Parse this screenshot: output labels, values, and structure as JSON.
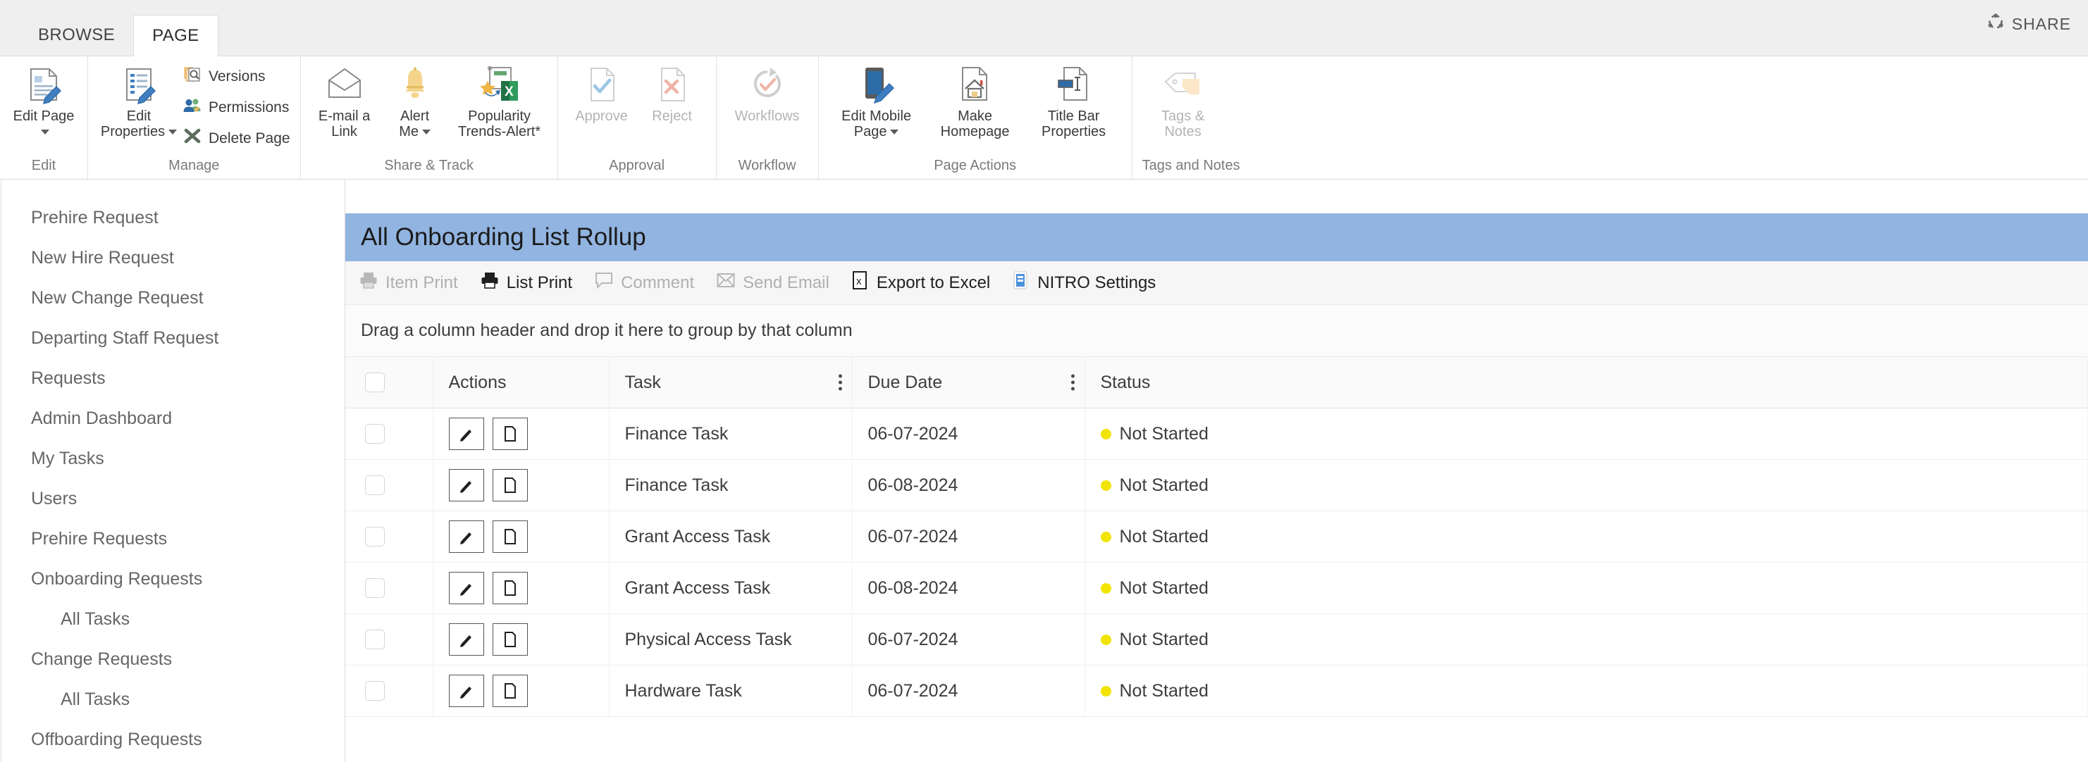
{
  "ribbon": {
    "tabs": [
      {
        "label": "BROWSE",
        "active": false
      },
      {
        "label": "PAGE",
        "active": true
      }
    ],
    "share_label": "SHARE",
    "groups": [
      {
        "label": "Edit",
        "buttons": [
          {
            "label": "Edit Page",
            "icon": "edit-page-icon",
            "dropdown": true,
            "disabled": false
          }
        ]
      },
      {
        "label": "Manage",
        "buttons": [
          {
            "label": "Edit\nProperties",
            "icon": "edit-properties-icon",
            "dropdown": true,
            "disabled": false
          }
        ],
        "small_items": [
          {
            "label": "Versions",
            "icon": "versions-icon"
          },
          {
            "label": "Permissions",
            "icon": "permissions-icon"
          },
          {
            "label": "Delete Page",
            "icon": "delete-page-icon"
          }
        ]
      },
      {
        "label": "Share & Track",
        "buttons": [
          {
            "label": "E-mail a\nLink",
            "icon": "email-link-icon",
            "dropdown": false,
            "disabled": false
          },
          {
            "label": "Alert\nMe",
            "icon": "alert-bell-icon",
            "dropdown": true,
            "disabled": false
          },
          {
            "label": "Popularity\nTrends-Alert*",
            "icon": "popularity-trends-icon",
            "dropdown": false,
            "disabled": false
          }
        ]
      },
      {
        "label": "Approval",
        "buttons": [
          {
            "label": "Approve",
            "icon": "approve-icon",
            "dropdown": false,
            "disabled": true
          },
          {
            "label": "Reject",
            "icon": "reject-icon",
            "dropdown": false,
            "disabled": true
          }
        ]
      },
      {
        "label": "Workflow",
        "buttons": [
          {
            "label": "Workflows",
            "icon": "workflows-icon",
            "dropdown": false,
            "disabled": true
          }
        ]
      },
      {
        "label": "Page Actions",
        "buttons": [
          {
            "label": "Edit Mobile\nPage",
            "icon": "edit-mobile-page-icon",
            "dropdown": true,
            "disabled": false
          },
          {
            "label": "Make\nHomepage",
            "icon": "make-homepage-icon",
            "dropdown": false,
            "disabled": false
          },
          {
            "label": "Title Bar\nProperties",
            "icon": "title-bar-properties-icon",
            "dropdown": false,
            "disabled": false
          }
        ]
      },
      {
        "label": "Tags and Notes",
        "buttons": [
          {
            "label": "Tags &\nNotes",
            "icon": "tags-notes-icon",
            "dropdown": false,
            "disabled": true
          }
        ]
      }
    ]
  },
  "sidebar": {
    "items": [
      {
        "label": "Prehire Request",
        "sub": false
      },
      {
        "label": "New Hire Request",
        "sub": false
      },
      {
        "label": "New Change Request",
        "sub": false
      },
      {
        "label": "Departing Staff Request",
        "sub": false
      },
      {
        "label": "Requests",
        "sub": false
      },
      {
        "label": "Admin Dashboard",
        "sub": false
      },
      {
        "label": "My Tasks",
        "sub": false
      },
      {
        "label": "Users",
        "sub": false
      },
      {
        "label": "Prehire Requests",
        "sub": false
      },
      {
        "label": "Onboarding Requests",
        "sub": false
      },
      {
        "label": "All Tasks",
        "sub": true
      },
      {
        "label": "Change Requests",
        "sub": false
      },
      {
        "label": "All Tasks",
        "sub": true
      },
      {
        "label": "Offboarding Requests",
        "sub": false
      }
    ]
  },
  "panel": {
    "title": "All Onboarding List Rollup",
    "title_bg": "#92b4e0",
    "commands": [
      {
        "label": "Item Print",
        "icon": "printer-icon",
        "disabled": true
      },
      {
        "label": "List Print",
        "icon": "printer-icon",
        "disabled": false
      },
      {
        "label": "Comment",
        "icon": "comment-icon",
        "disabled": true
      },
      {
        "label": "Send Email",
        "icon": "envelope-icon",
        "disabled": true
      },
      {
        "label": "Export to Excel",
        "icon": "excel-icon",
        "disabled": false
      },
      {
        "label": "NITRO Settings",
        "icon": "nitro-settings-icon",
        "disabled": false
      }
    ],
    "group_hint": "Drag a column header and drop it here to group by that column",
    "grid": {
      "columns": [
        {
          "label": "",
          "kebab": false,
          "key": "checkbox"
        },
        {
          "label": "Actions",
          "kebab": false,
          "key": "actions"
        },
        {
          "label": "Task",
          "kebab": true,
          "key": "task"
        },
        {
          "label": "Due Date",
          "kebab": true,
          "key": "due"
        },
        {
          "label": "Status",
          "kebab": false,
          "key": "status"
        }
      ],
      "status_dot_color": "#f0e400",
      "rows": [
        {
          "task": "Finance Task",
          "due": "06-07-2024",
          "status": "Not Started"
        },
        {
          "task": "Finance Task",
          "due": "06-08-2024",
          "status": "Not Started"
        },
        {
          "task": "Grant Access Task",
          "due": "06-07-2024",
          "status": "Not Started"
        },
        {
          "task": "Grant Access Task",
          "due": "06-08-2024",
          "status": "Not Started"
        },
        {
          "task": "Physical Access Task",
          "due": "06-07-2024",
          "status": "Not Started"
        },
        {
          "task": "Hardware Task",
          "due": "06-07-2024",
          "status": "Not Started"
        }
      ]
    }
  }
}
